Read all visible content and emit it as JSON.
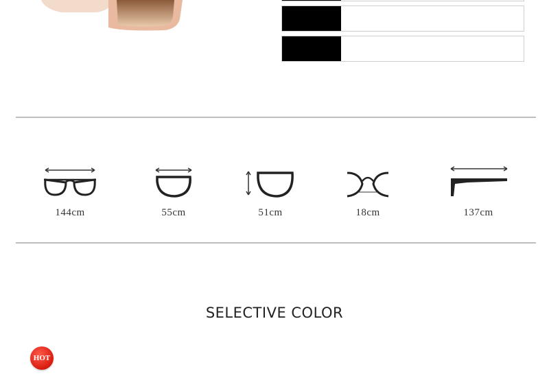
{
  "spec_table": {
    "rows": 3
  },
  "measurements": [
    {
      "id": "frame-width",
      "label": "144cm",
      "icon": "glasses-front-width-icon"
    },
    {
      "id": "lens-width",
      "label": "55cm",
      "icon": "lens-width-icon"
    },
    {
      "id": "lens-height",
      "label": "51cm",
      "icon": "lens-height-icon"
    },
    {
      "id": "bridge-width",
      "label": "18cm",
      "icon": "bridge-width-icon"
    },
    {
      "id": "temple-length",
      "label": "137cm",
      "icon": "temple-length-icon"
    }
  ],
  "section": {
    "title": "SELECTIVE COLOR"
  },
  "badge": {
    "label": "HOT",
    "color": "#d81c10"
  }
}
